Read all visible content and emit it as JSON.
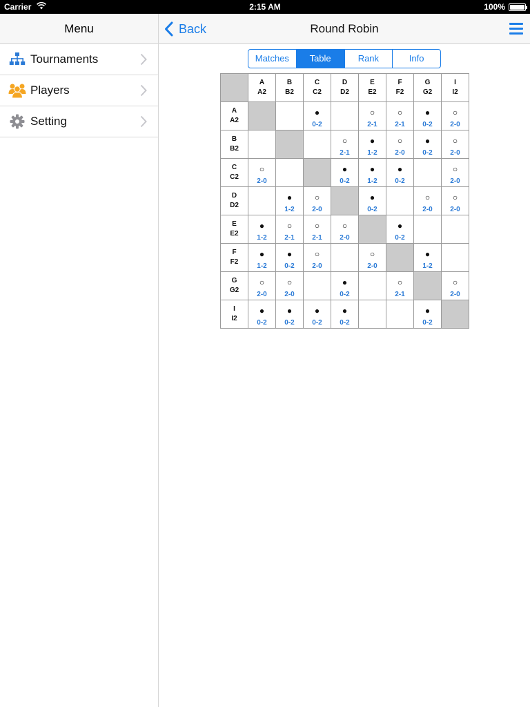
{
  "status_bar": {
    "carrier": "Carrier",
    "time": "2:15 AM",
    "battery": "100%"
  },
  "sidebar": {
    "title": "Menu",
    "items": [
      {
        "label": "Tournaments",
        "icon": "tournament-tree-icon",
        "color": "#2a7ad6"
      },
      {
        "label": "Players",
        "icon": "players-group-icon",
        "color": "#f5a623"
      },
      {
        "label": "Setting",
        "icon": "gear-icon",
        "color": "#8e8e93"
      }
    ]
  },
  "navbar": {
    "back_label": "Back",
    "title": "Round Robin",
    "menu_icon": "hamburger-menu-icon"
  },
  "segments": [
    {
      "label": "Matches",
      "active": false
    },
    {
      "label": "Table",
      "active": true
    },
    {
      "label": "Rank",
      "active": false
    },
    {
      "label": "Info",
      "active": false
    }
  ],
  "colors": {
    "accent": "#1a7de8",
    "score": "#2a7ad6",
    "diagonal": "#cbcbcb"
  },
  "players": [
    {
      "code": "A",
      "name": "A2"
    },
    {
      "code": "B",
      "name": "B2"
    },
    {
      "code": "C",
      "name": "C2"
    },
    {
      "code": "D",
      "name": "D2"
    },
    {
      "code": "E",
      "name": "E2"
    },
    {
      "code": "F",
      "name": "F2"
    },
    {
      "code": "G",
      "name": "G2"
    },
    {
      "code": "I",
      "name": "I2"
    }
  ],
  "results": [
    [
      null,
      null,
      {
        "mark": "●",
        "score": "0-2"
      },
      null,
      {
        "mark": "○",
        "score": "2-1"
      },
      {
        "mark": "○",
        "score": "2-1"
      },
      {
        "mark": "●",
        "score": "0-2"
      },
      {
        "mark": "○",
        "score": "2-0"
      }
    ],
    [
      null,
      null,
      null,
      {
        "mark": "○",
        "score": "2-1"
      },
      {
        "mark": "●",
        "score": "1-2"
      },
      {
        "mark": "○",
        "score": "2-0"
      },
      {
        "mark": "●",
        "score": "0-2"
      },
      {
        "mark": "○",
        "score": "2-0"
      }
    ],
    [
      {
        "mark": "○",
        "score": "2-0"
      },
      null,
      null,
      {
        "mark": "●",
        "score": "0-2"
      },
      {
        "mark": "●",
        "score": "1-2"
      },
      {
        "mark": "●",
        "score": "0-2"
      },
      null,
      {
        "mark": "○",
        "score": "2-0"
      }
    ],
    [
      null,
      {
        "mark": "●",
        "score": "1-2"
      },
      {
        "mark": "○",
        "score": "2-0"
      },
      null,
      {
        "mark": "●",
        "score": "0-2"
      },
      null,
      {
        "mark": "○",
        "score": "2-0"
      },
      {
        "mark": "○",
        "score": "2-0"
      }
    ],
    [
      {
        "mark": "●",
        "score": "1-2"
      },
      {
        "mark": "○",
        "score": "2-1"
      },
      {
        "mark": "○",
        "score": "2-1"
      },
      {
        "mark": "○",
        "score": "2-0"
      },
      null,
      {
        "mark": "●",
        "score": "0-2"
      },
      null,
      null
    ],
    [
      {
        "mark": "●",
        "score": "1-2"
      },
      {
        "mark": "●",
        "score": "0-2"
      },
      {
        "mark": "○",
        "score": "2-0"
      },
      null,
      {
        "mark": "○",
        "score": "2-0"
      },
      null,
      {
        "mark": "●",
        "score": "1-2"
      },
      null
    ],
    [
      {
        "mark": "○",
        "score": "2-0"
      },
      {
        "mark": "○",
        "score": "2-0"
      },
      null,
      {
        "mark": "●",
        "score": "0-2"
      },
      null,
      {
        "mark": "○",
        "score": "2-1"
      },
      null,
      {
        "mark": "○",
        "score": "2-0"
      }
    ],
    [
      {
        "mark": "●",
        "score": "0-2"
      },
      {
        "mark": "●",
        "score": "0-2"
      },
      {
        "mark": "●",
        "score": "0-2"
      },
      {
        "mark": "●",
        "score": "0-2"
      },
      null,
      null,
      {
        "mark": "●",
        "score": "0-2"
      },
      null
    ]
  ]
}
